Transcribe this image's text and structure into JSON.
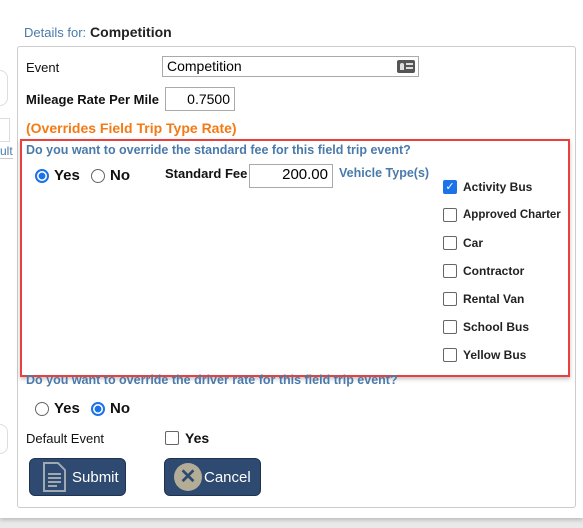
{
  "header": {
    "label": "Details for:",
    "value": "Competition"
  },
  "background": {
    "fragment_text": "ult"
  },
  "form": {
    "event_label": "Event",
    "event_value": "Competition",
    "mileage_label": "Mileage Rate Per Mile",
    "mileage_value": "0.7500",
    "override_note": "(Overrides Field Trip Type Rate)",
    "fee_question": "Do you want to override the standard fee for this field trip event?",
    "fee_yes": "Yes",
    "fee_no": "No",
    "fee_override": "Yes",
    "standard_fee_label": "Standard Fee",
    "standard_fee_value": "200.00",
    "vehicle_types_label": "Vehicle Type(s)",
    "vehicles": [
      {
        "label": "Activity Bus",
        "checked": true
      },
      {
        "label": "Approved Charter",
        "checked": false
      },
      {
        "label": "Car",
        "checked": false
      },
      {
        "label": "Contractor",
        "checked": false
      },
      {
        "label": "Rental Van",
        "checked": false
      },
      {
        "label": "School Bus",
        "checked": false
      },
      {
        "label": "Yellow Bus",
        "checked": false
      }
    ],
    "driver_question": "Do you want to override the driver rate for this field trip event?",
    "driver_yes": "Yes",
    "driver_no": "No",
    "driver_override": "No",
    "default_event_label": "Default Event",
    "default_event_yes": "Yes",
    "default_event_checked": false,
    "submit_label": "Submit",
    "cancel_label": "Cancel"
  },
  "colors": {
    "accent": "#4a7aab",
    "warning": "#f47a15",
    "highlight_border": "#e8403f",
    "button": "#2e4a70",
    "checked": "#1a73e8"
  }
}
